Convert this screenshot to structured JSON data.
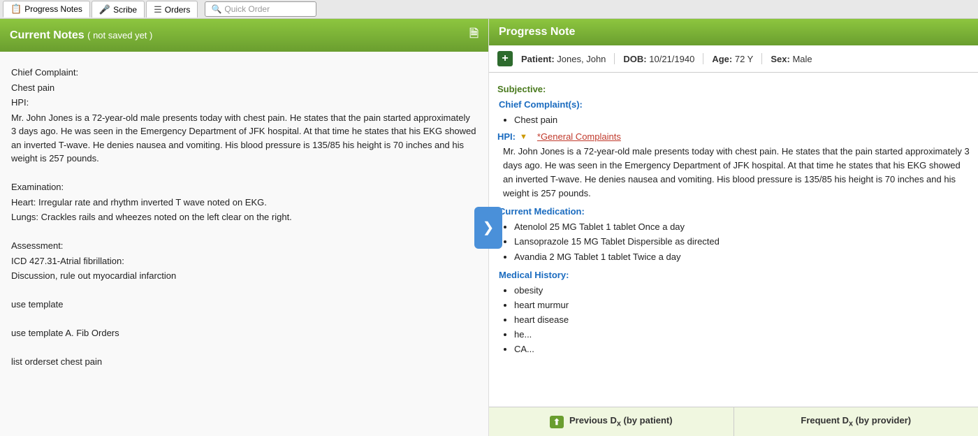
{
  "tabs": [
    {
      "id": "progress-notes",
      "label": "Progress Notes",
      "icon": "📋",
      "active": true
    },
    {
      "id": "scribe",
      "label": "Scribe",
      "icon": "🎤",
      "active": false
    },
    {
      "id": "orders",
      "label": "Orders",
      "icon": "📋",
      "active": false
    }
  ],
  "quick_order": {
    "placeholder": "Quick Order"
  },
  "left_panel": {
    "header": "Current Notes",
    "not_saved_label": "( not saved yet )",
    "content": {
      "chief_complaint_label": "Chief Complaint:",
      "chief_complaint_value": "Chest pain",
      "hpi_label": "HPI:",
      "hpi_text": "Mr. John Jones is a 72-year-old male presents today with chest pain.  He states that the pain started approximately 3 days ago.  He was seen in the Emergency Department of JFK hospital.  At that time he states that his EKG showed an inverted T-wave.  He denies nausea and vomiting.  His blood pressure is 135/85 his height is 70 inches and his weight is 257 pounds.",
      "examination_label": "Examination:",
      "heart_line": "Heart: Irregular rate and rhythm inverted T wave noted on EKG.",
      "lungs_line": "Lungs: Crackles rails and wheezes noted on the left clear on the right.",
      "assessment_label": "Assessment:",
      "icd_line": "ICD 427.31-Atrial fibrillation:",
      "discussion_line": "Discussion, rule out myocardial infarction",
      "use_template_1": "use template",
      "use_template_2": "use template A. Fib Orders",
      "list_orderset": "list orderset chest pain"
    }
  },
  "right_panel": {
    "header": "Progress Note",
    "patient": {
      "label": "Patient:",
      "name": "Jones, John",
      "dob_label": "DOB:",
      "dob": "10/21/1940",
      "age_label": "Age:",
      "age": "72 Y",
      "sex_label": "Sex:",
      "sex": "Male"
    },
    "subjective_label": "Subjective:",
    "chief_complaints_label": "Chief Complaint(s):",
    "chief_complaints": [
      "Chest pain"
    ],
    "hpi_label": "HPI:",
    "general_complaints_link": "*General Complaints",
    "hpi_text": "Mr. John Jones is a 72-year-old male presents today with chest pain. He states that the pain started approximately 3 days ago. He was seen in the Emergency Department of JFK hospital. At that time he states that his EKG showed an inverted T-wave. He denies nausea and vomiting. His blood pressure is 135/85 his height is 70 inches and his weight is 257 pounds.",
    "current_medication_label": "Current Medication:",
    "medications": [
      "Atenolol 25 MG Tablet 1 tablet Once a day",
      "Lansoprazole 15 MG Tablet Dispersible as directed",
      "Avandia 2 MG Tablet 1 tablet Twice a day"
    ],
    "medical_history_label": "Medical History:",
    "history_items": [
      "obesity",
      "heart murmur",
      "heart disease",
      "he...",
      "CA..."
    ],
    "prev_dx_label": "Previous D",
    "prev_dx_sub": "x",
    "prev_dx_suffix": "(by patient)",
    "freq_dx_label": "Frequent D",
    "freq_dx_sub": "x",
    "freq_dx_suffix": "(by provider)"
  },
  "arrow_button": {
    "icon": "❯"
  }
}
